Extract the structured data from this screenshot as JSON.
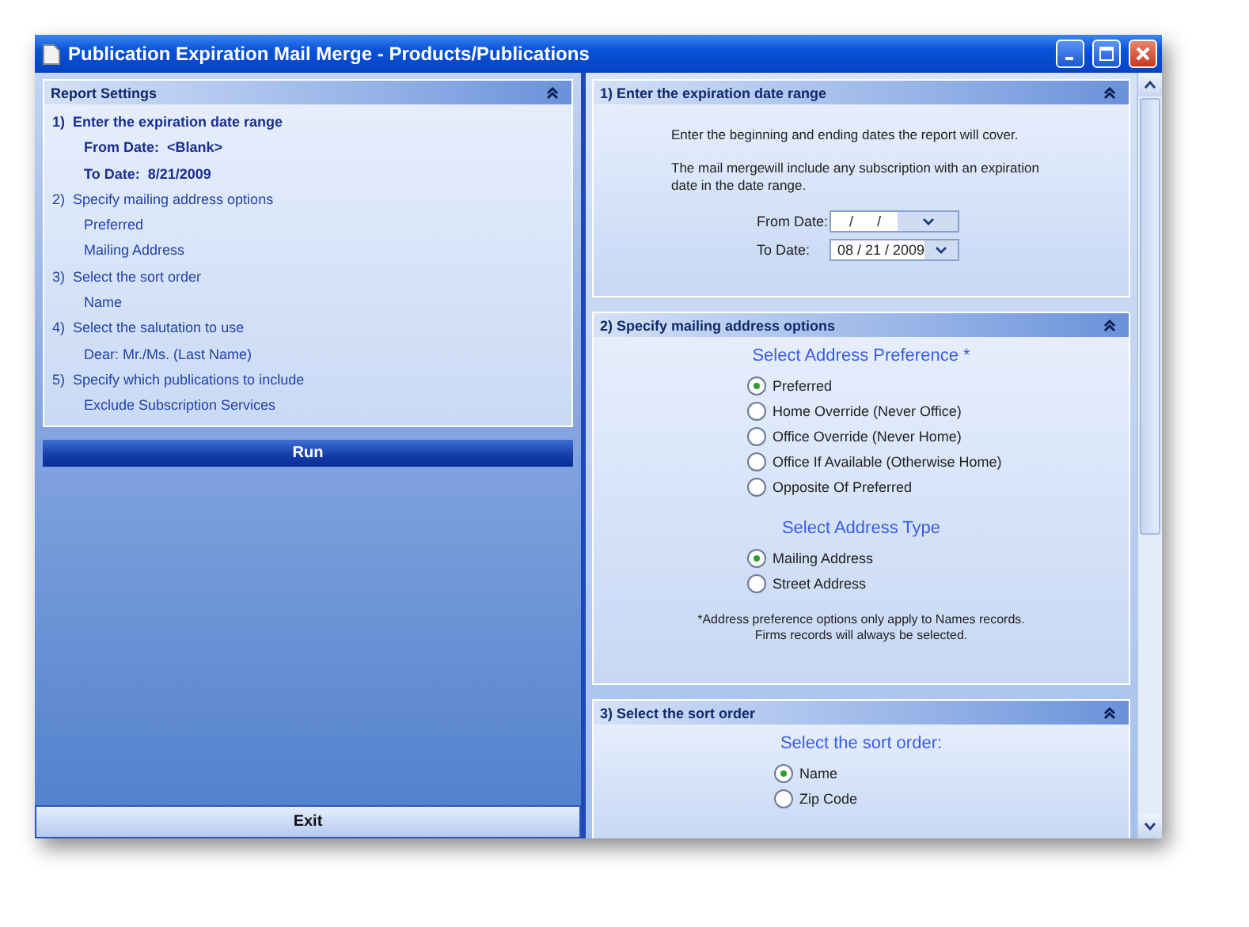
{
  "window": {
    "title": "Publication Expiration Mail Merge - Products/Publications"
  },
  "report_settings": {
    "title": "Report Settings",
    "items": [
      {
        "text": "1)  Enter the expiration date range",
        "kind": "step",
        "emphasized": true
      },
      {
        "text": "From Date:  <Blank>",
        "kind": "detail",
        "emphasized": true
      },
      {
        "text": "To Date:  8/21/2009",
        "kind": "detail",
        "emphasized": true
      },
      {
        "text": "2)  Specify mailing address options",
        "kind": "step",
        "emphasized": false
      },
      {
        "text": "Preferred",
        "kind": "detail",
        "emphasized": false
      },
      {
        "text": "Mailing Address",
        "kind": "detail",
        "emphasized": false
      },
      {
        "text": "3)  Select the sort order",
        "kind": "step",
        "emphasized": false
      },
      {
        "text": "Name",
        "kind": "detail",
        "emphasized": false
      },
      {
        "text": "4)  Select the salutation to use",
        "kind": "step",
        "emphasized": false
      },
      {
        "text": "Dear: Mr./Ms. (Last Name)",
        "kind": "detail",
        "emphasized": false
      },
      {
        "text": "5)  Specify which publications to include",
        "kind": "step",
        "emphasized": false
      },
      {
        "text": "Exclude Subscription Services",
        "kind": "detail",
        "emphasized": false
      }
    ]
  },
  "run_button": "Run",
  "exit_button": "Exit",
  "sections": [
    {
      "kind": "dates",
      "title": "1)  Enter the expiration date range",
      "paragraphs": [
        "Enter the beginning and ending dates the report will cover.",
        "The mail mergewill include any subscription with an expiration date in the date range."
      ],
      "fields": [
        {
          "label": "From Date:",
          "value": "   /      /"
        },
        {
          "label": "To Date:",
          "value": "08 / 21 / 2009"
        }
      ]
    },
    {
      "kind": "options",
      "title": "2)  Specify mailing address options",
      "groups": [
        {
          "heading": "Select Address Preference *",
          "options": [
            {
              "label": "Preferred",
              "selected": true
            },
            {
              "label": "Home Override (Never Office)",
              "selected": false
            },
            {
              "label": "Office Override (Never Home)",
              "selected": false
            },
            {
              "label": "Office If Available (Otherwise Home)",
              "selected": false
            },
            {
              "label": "Opposite Of Preferred",
              "selected": false
            }
          ]
        },
        {
          "heading": "Select Address Type",
          "options": [
            {
              "label": "Mailing Address",
              "selected": true
            },
            {
              "label": "Street Address",
              "selected": false
            }
          ]
        }
      ],
      "note": [
        "*Address preference options only apply to Names records.",
        "Firms records will always be selected."
      ]
    },
    {
      "kind": "options",
      "title": "3)  Select the sort order",
      "groups": [
        {
          "heading": "Select the sort order:",
          "options": [
            {
              "label": "Name",
              "selected": true
            },
            {
              "label": "Zip Code",
              "selected": false
            }
          ]
        }
      ]
    }
  ]
}
